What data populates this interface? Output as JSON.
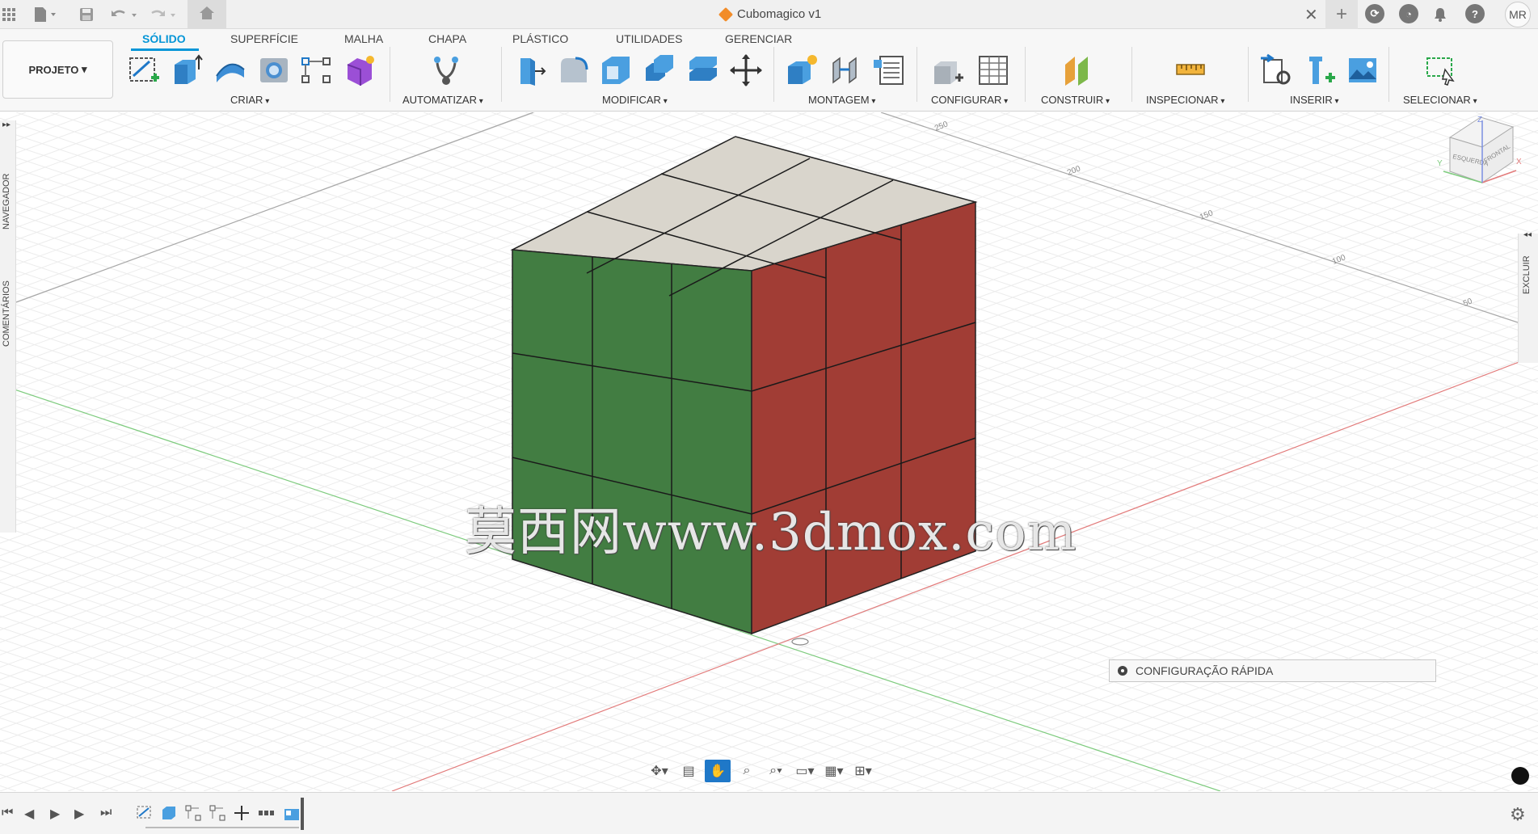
{
  "window": {
    "title": "Cubomagico v1",
    "user_initials": "MR"
  },
  "toolbar": {
    "project_label": "PROJETO",
    "tabs": [
      "SÓLIDO",
      "SUPERFÍCIE",
      "MALHA",
      "CHAPA",
      "PLÁSTICO",
      "UTILIDADES",
      "GERENCIAR"
    ],
    "active_tab": "SÓLIDO",
    "groups": [
      "CRIAR",
      "AUTOMATIZAR",
      "MODIFICAR",
      "MONTAGEM",
      "CONFIGURAR",
      "CONSTRUIR",
      "INSPECIONAR",
      "INSERIR",
      "SELECIONAR"
    ]
  },
  "viewport": {
    "side_panels": {
      "left": [
        "NAVEGADOR",
        "COMENTÁRIOS"
      ],
      "right": "EXCLUIR"
    },
    "view_cube_faces": [
      "ESQUERDA",
      "FRONTAL"
    ],
    "view_cube_axes": [
      "X",
      "Y",
      "Z"
    ],
    "grid_scale_labels": [
      "250",
      "200",
      "150",
      "100",
      "50"
    ],
    "quick_setup_label": "CONFIGURAÇÃO RÁPIDA",
    "watermark": "莫西网www.3dmox.com",
    "model_colors": {
      "top": "#d9d5cc",
      "left": "#427d42",
      "right": "#a13d35"
    }
  },
  "timeline": {
    "label": "timeline"
  }
}
